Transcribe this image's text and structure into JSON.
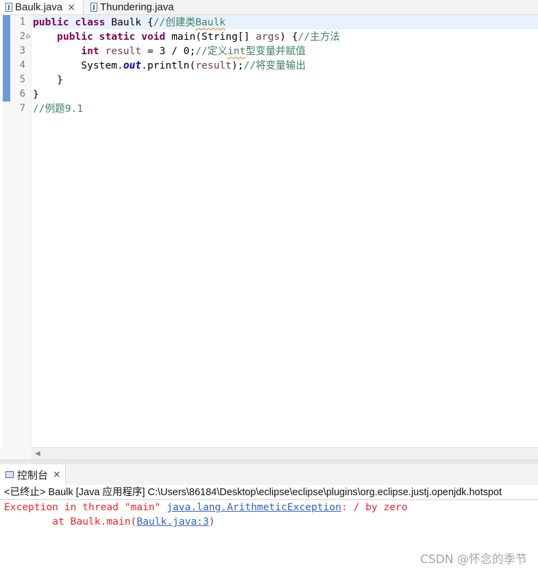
{
  "editor_tabs": [
    {
      "label": "Baulk.java",
      "close": "×"
    },
    {
      "label": "Thundering.java"
    }
  ],
  "line_numbers": [
    "1",
    "2",
    "3",
    "4",
    "5",
    "6",
    "7"
  ],
  "code": {
    "l1": {
      "kw1": "public",
      "kw2": "class",
      "name": " Baulk {",
      "comment_a": "//创建类",
      "comment_b": "Baulk"
    },
    "l2": {
      "indent": "    ",
      "kw1": "public",
      "kw2": "static",
      "kw3": "void",
      "mid": " main(String[] ",
      "param": "args",
      "end": ") {",
      "comment": "//主方法"
    },
    "l3": {
      "indent": "        ",
      "kw": "int",
      "var": "result",
      "expr": " = 3 / 0;",
      "comment_a": "//定义",
      "comment_b": "int",
      "comment_c": "型变量并赋值"
    },
    "l4": {
      "indent": "        ",
      "pre": "System.",
      "field": "out",
      "call": ".println(",
      "var": "result",
      "end": ");",
      "comment": "//将变量输出"
    },
    "l5": {
      "text": "    }"
    },
    "l6": {
      "text": "}"
    },
    "l7": {
      "comment": "//例题9.1"
    }
  },
  "console": {
    "tab_label": "控制台",
    "tab_close": "×",
    "description": "<已终止> Baulk [Java 应用程序] C:\\Users\\86184\\Desktop\\eclipse\\eclipse\\plugins\\org.eclipse.justj.openjdk.hotspot",
    "error_line1": {
      "prefix": "Exception in thread \"main\" ",
      "exception_link": "java.lang.ArithmeticException",
      "suffix": ": / by zero"
    },
    "error_line2": {
      "prefix": "\tat Baulk.main(",
      "source_link": "Baulk.java:3",
      "suffix": ")"
    }
  },
  "watermark": "CSDN @怀念的季节",
  "colors": {
    "keyword": "#7f0055",
    "comment": "#3f7f5f",
    "error": "#ff1c1c",
    "link": "#2f5fc9",
    "marker": "#6e9bd3"
  }
}
